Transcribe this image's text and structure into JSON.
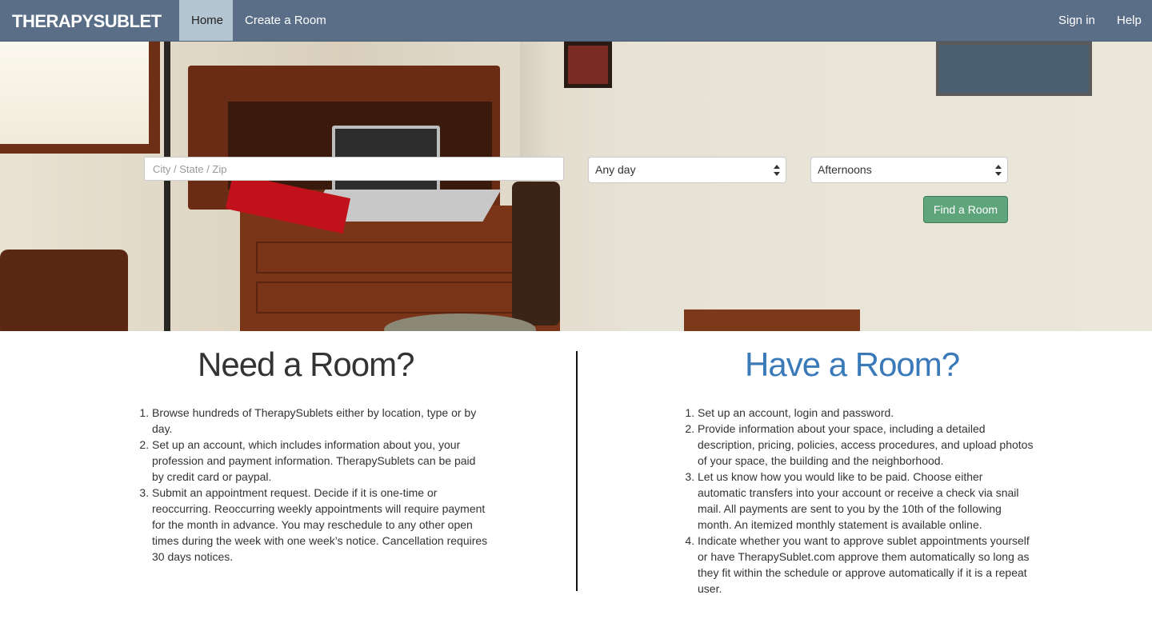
{
  "navbar": {
    "brand": "THERAPYSUBLET",
    "items": [
      {
        "label": "Home",
        "active": true
      },
      {
        "label": "Create a Room",
        "active": false
      }
    ],
    "right_items": [
      {
        "label": "Sign in"
      },
      {
        "label": "Help"
      }
    ],
    "colors": {
      "background": "#5a6f87",
      "active_background": "#b3c5d1"
    }
  },
  "search": {
    "location_placeholder": "City / State / Zip",
    "location_value": "",
    "day_selected": "Any day",
    "time_selected": "Afternoons",
    "submit_label": "Find a Room",
    "submit_color": "#5ea57b"
  },
  "need": {
    "heading": "Need a Room?",
    "steps": [
      "Browse hundreds of TherapySublets either by location, type or by day.",
      "Set up an account, which includes information about you, your profession and payment information. TherapySublets can be paid by credit card or paypal.",
      "Submit an appointment request. Decide if it is one-time or reoccurring. Reoccurring weekly appointments will require payment for the month in advance. You may reschedule to any other open times during the week with one week’s notice. Cancellation requires 30 days notices."
    ]
  },
  "have": {
    "heading": "Have a Room?",
    "heading_color": "#3b7ab8",
    "steps": [
      "Set up an account, login and password.",
      "Provide information about your space, including a detailed description, pricing, policies, access procedures, and upload photos of your space, the building and the neighborhood.",
      "Let us know how you would like to be paid. Choose either automatic transfers into your account or receive a check via snail mail. All payments are sent to you by the 10th of the following month. An itemized monthly statement is available online.",
      "Indicate whether you want to approve sublet appointments yourself or have TherapySublet.com approve them automatically so long as they fit within the schedule or approve automatically if it is a repeat user."
    ]
  }
}
